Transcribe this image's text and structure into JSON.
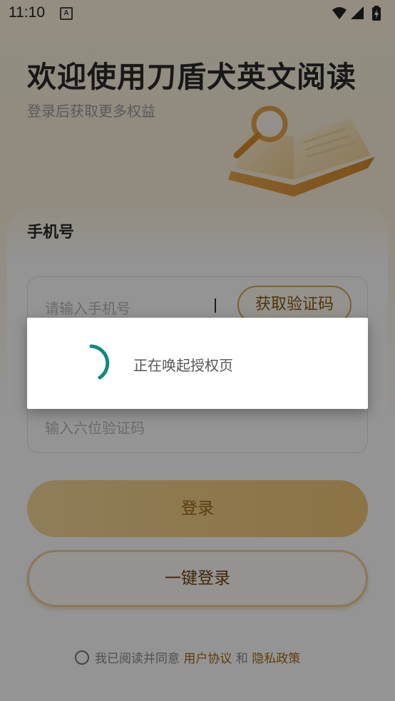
{
  "status_bar": {
    "time": "11:10",
    "notification_icon": "A"
  },
  "header": {
    "title": "欢迎使用刀盾犬英文阅读",
    "subtitle": "登录后获取更多权益"
  },
  "form": {
    "phone_label": "手机号",
    "phone_placeholder": "请输入手机号",
    "get_code_label": "获取验证码",
    "code_placeholder": "输入六位验证码",
    "login_label": "登录",
    "one_key_login_label": "一键登录"
  },
  "agreement": {
    "prefix": "我已阅读并同意",
    "user_agreement": "用户协议",
    "and": "和",
    "privacy_policy": "隐私政策"
  },
  "dialog": {
    "message": "正在唤起授权页"
  },
  "colors": {
    "accent": "#d9a84a",
    "spinner": "#0f8a7e",
    "link": "#a06a10"
  }
}
